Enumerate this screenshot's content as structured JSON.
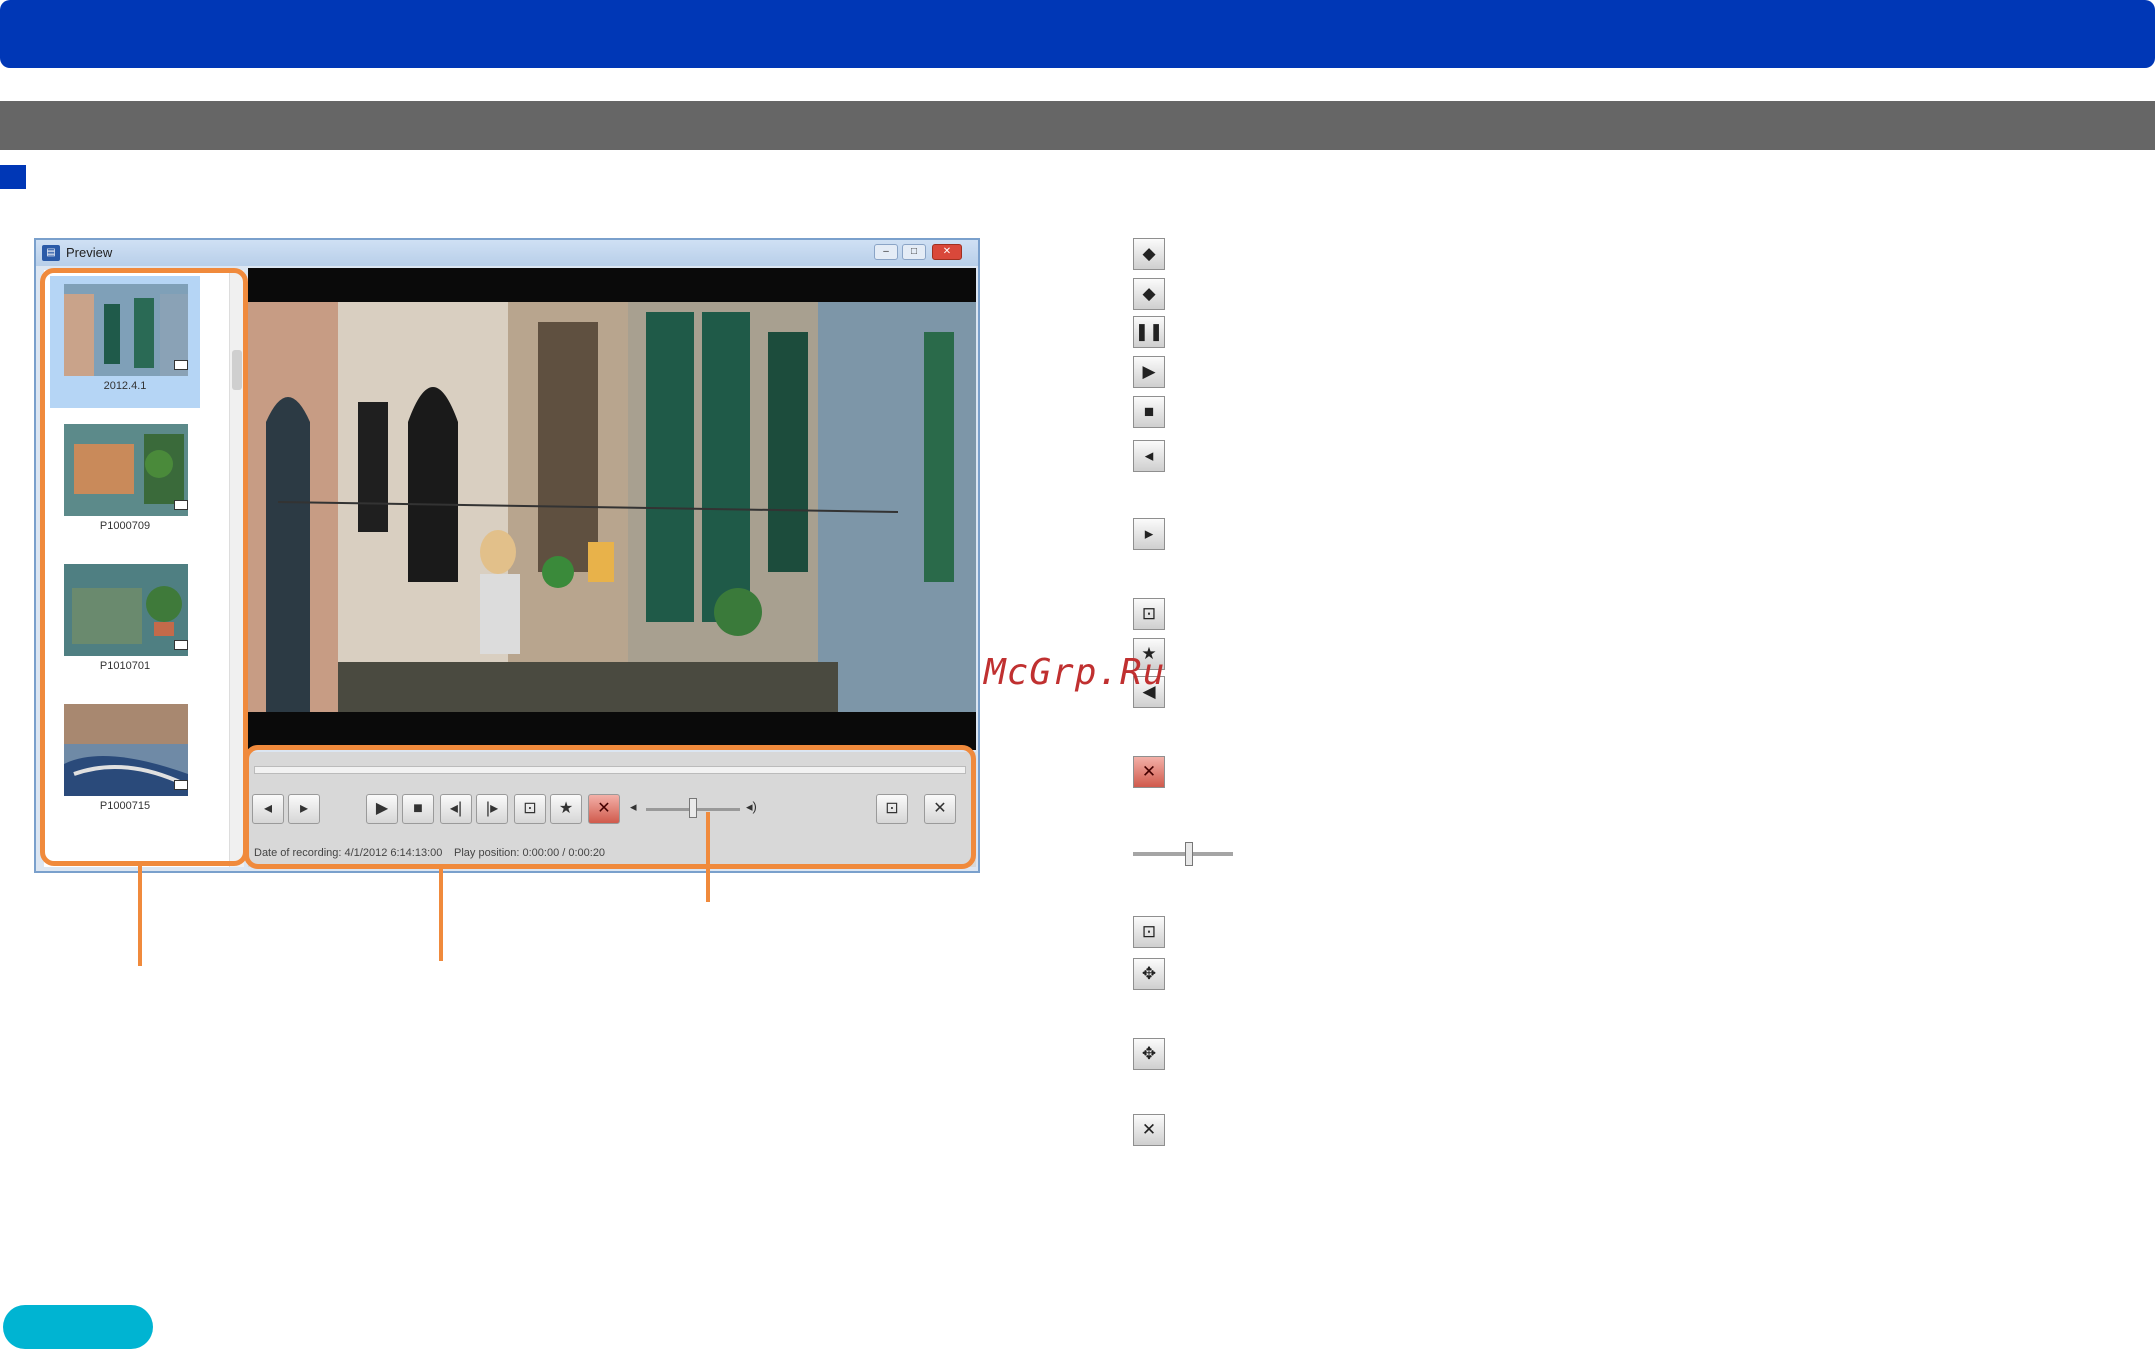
{
  "colors": {
    "header": "#0037b6",
    "subheader": "#666666",
    "highlight": "#f08a3c",
    "pill": "#00b4d2",
    "watermark": "#c03030"
  },
  "window": {
    "title": "Preview",
    "icon": "preview-app-icon",
    "title_buttons": {
      "minimize": "–",
      "maximize": "□",
      "close": "✕"
    }
  },
  "thumbnails": [
    {
      "label": "2012.4.1",
      "selected": true,
      "badge": "movie-badge-icon"
    },
    {
      "label": "P1000709",
      "selected": false,
      "badge": "movie-badge-icon"
    },
    {
      "label": "P1010701",
      "selected": false,
      "badge": "movie-badge-icon"
    },
    {
      "label": "P1000715",
      "selected": false,
      "badge": "movie-badge-icon"
    }
  ],
  "controls": {
    "buttons": [
      {
        "name": "previous-scene-button",
        "icon": "◂"
      },
      {
        "name": "next-scene-button",
        "icon": "▸"
      },
      {
        "name": "play-button",
        "icon": "▶"
      },
      {
        "name": "stop-button",
        "icon": "■"
      },
      {
        "name": "frame-back-button",
        "icon": "◂|"
      },
      {
        "name": "frame-forward-button",
        "icon": "|▸"
      },
      {
        "name": "save-still-button",
        "icon": "⊡"
      },
      {
        "name": "favorite-button",
        "icon": "★"
      },
      {
        "name": "mute-button",
        "icon": "✕"
      }
    ],
    "volume_level": 0.5,
    "fullscreen_icon": "⊡",
    "close_icon": "✕",
    "date_of_recording": "Date of recording: 4/1/2012 6:14:13:00",
    "play_position": "Play position:  0:00:00 / 0:00:20"
  },
  "icon_list": [
    {
      "name": "previous-scene-icon",
      "glyph": "◆"
    },
    {
      "name": "next-scene-icon",
      "glyph": "◆"
    },
    {
      "name": "pause-icon",
      "glyph": "❚❚"
    },
    {
      "name": "play-icon",
      "glyph": "▶"
    },
    {
      "name": "stop-icon",
      "glyph": "■"
    },
    {
      "name": "frame-back-icon",
      "glyph": "◂"
    },
    {
      "name": "frame-forward-icon",
      "glyph": "▸"
    },
    {
      "name": "save-still-icon",
      "glyph": "⊡"
    },
    {
      "name": "favorite-icon",
      "glyph": "★"
    },
    {
      "name": "volume-icon",
      "glyph": "◀"
    },
    {
      "name": "mute-icon",
      "glyph": "✕"
    },
    {
      "name": "fullscreen-icon",
      "glyph": "⊡"
    },
    {
      "name": "expand-icon",
      "glyph": "✥"
    },
    {
      "name": "restore-icon",
      "glyph": "✥"
    },
    {
      "name": "close-icon",
      "glyph": "✕"
    }
  ],
  "watermark": "McGrp.Ru"
}
